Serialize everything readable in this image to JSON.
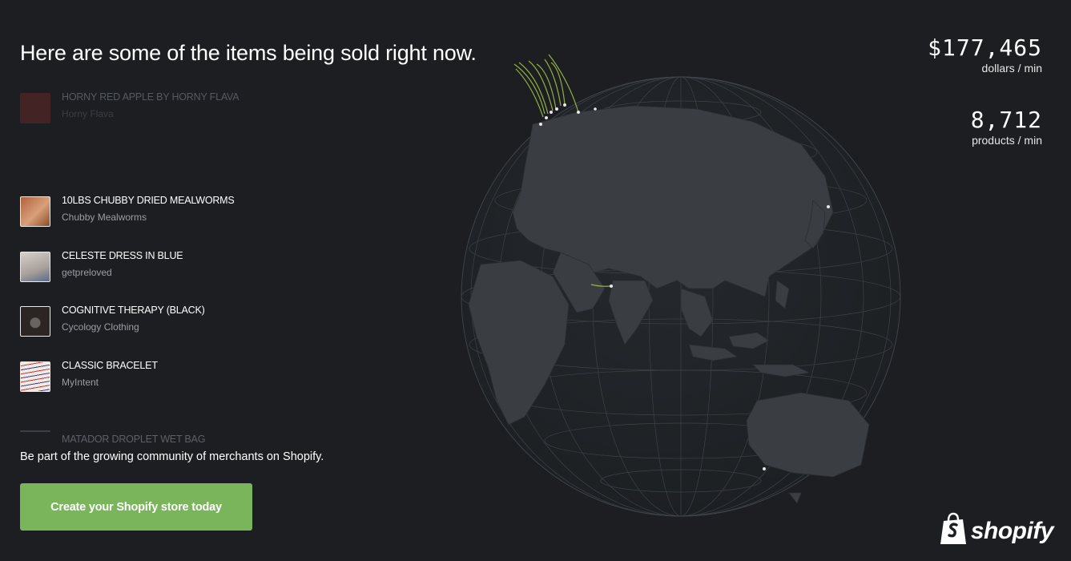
{
  "headline": "Here are some of the items being sold right now.",
  "feed": {
    "items": [
      {
        "title": "HORNY RED APPLE BY HORNY FLAVA",
        "merchant": "Horny Flava",
        "thumb_color": "#c9443a",
        "icon": "sauce-bottle-thumbnail"
      },
      {
        "title": "10LBS CHUBBY DRIED MEALWORMS",
        "merchant": "Chubby Mealworms",
        "thumb_color": "#b0623c",
        "icon": "mealworm-bag-thumbnail"
      },
      {
        "title": "CELESTE DRESS IN BLUE",
        "merchant": "getpreloved",
        "thumb_color": "#b9b3ad",
        "icon": "dress-thumbnail"
      },
      {
        "title": "COGNITIVE THERAPY (BLACK)",
        "merchant": "Cycology Clothing",
        "thumb_color": "#2b2623",
        "icon": "tshirt-thumbnail"
      },
      {
        "title": "CLASSIC BRACELET",
        "merchant": "MyIntent",
        "thumb_color": "#e9e4de",
        "icon": "bracelet-thumbnail"
      },
      {
        "title": "MATADOR DROPLET WET BAG",
        "merchant": "",
        "thumb_color": "#3b4046",
        "icon": "bag-thumbnail"
      }
    ]
  },
  "stats": {
    "dollars": {
      "value": "$177,465",
      "label": "dollars / min"
    },
    "products": {
      "value": "8,712",
      "label": "products / min"
    }
  },
  "cta": {
    "text": "Be part of the growing community of merchants on Shopify.",
    "button_label": "Create your Shopify store today"
  },
  "logo": {
    "text": "shopify",
    "icon": "shopping-bag-icon"
  },
  "colors": {
    "background": "#1c1e21",
    "land": "#3a3e42",
    "ocean": "#212428",
    "grid": "#4b5055",
    "accent": "#7ab55c",
    "order_line": "#a6c94a"
  }
}
